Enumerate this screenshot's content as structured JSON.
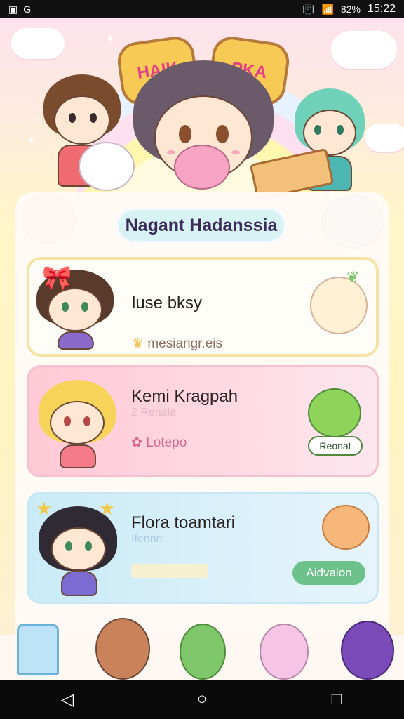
{
  "status_bar": {
    "left_icons": [
      "image-icon",
      "signal-ext-icon"
    ],
    "left_text": "G",
    "battery": "82%",
    "time": "15:22"
  },
  "header": {
    "badge_left": "HAIK",
    "badge_right": "PKA"
  },
  "section_title": "Nagant Hadanssia",
  "cards": [
    {
      "name": "luse bksy",
      "tag": "mesiangr.eis",
      "mascot": "sprout-icon"
    },
    {
      "name": "Kemi Kragpah",
      "sub": "2 Renaia",
      "tag": "Lotepo",
      "mascot": "alien-icon",
      "mascot_label": "Reonat"
    },
    {
      "name": "Flora toamtari",
      "sub": "Ifennn",
      "button": "Aidvalon",
      "mascot": "bear-icon"
    }
  ],
  "colors": {
    "accent_pink": "#f48aa8",
    "accent_green": "#6cc28a",
    "title_text": "#3b2a5a"
  },
  "bottom_nav_icons": [
    "house-icon",
    "girl-avatar",
    "boy-avatar",
    "cat-avatar",
    "purple-girl-avatar"
  ],
  "system_nav": {
    "back": "◁",
    "home": "○",
    "recents": "□"
  }
}
